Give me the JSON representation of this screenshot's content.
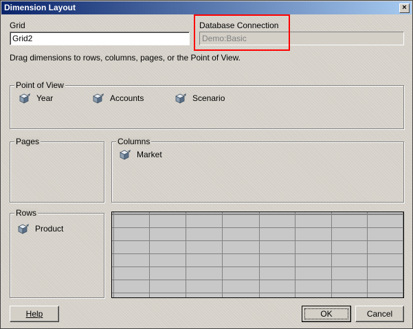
{
  "window": {
    "title": "Dimension Layout",
    "close_label": "×"
  },
  "grid_field": {
    "label": "Grid",
    "value": "Grid2"
  },
  "db_field": {
    "label": "Database Connection",
    "value": "Demo:Basic"
  },
  "instructions": "Drag dimensions to rows, columns, pages, or the Point of View.",
  "pov": {
    "label": "Point of View",
    "items": [
      "Year",
      "Accounts",
      "Scenario"
    ]
  },
  "pages": {
    "label": "Pages"
  },
  "columns": {
    "label": "Columns",
    "items": [
      "Market"
    ]
  },
  "rows": {
    "label": "Rows",
    "items": [
      "Product"
    ]
  },
  "buttons": {
    "help": "Help",
    "ok": "OK",
    "cancel": "Cancel"
  },
  "colors": {
    "highlight": "#ff0000",
    "title_bar": "#0a246a"
  }
}
